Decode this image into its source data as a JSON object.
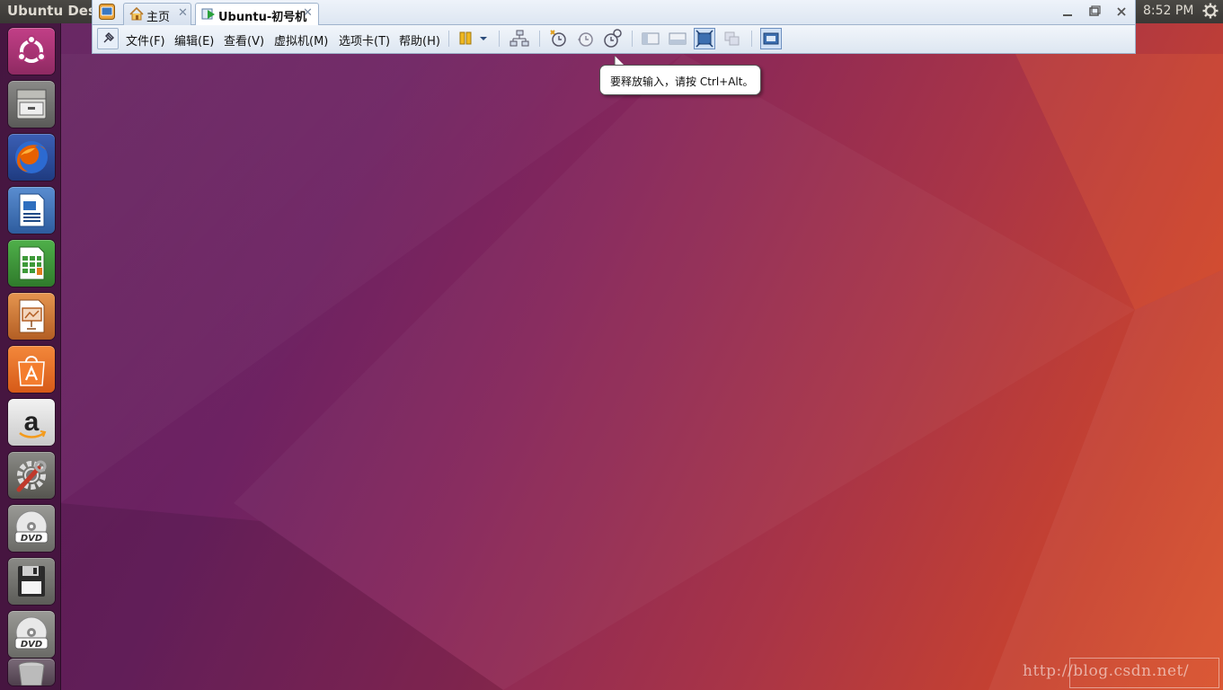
{
  "panel": {
    "title": "Ubuntu Desktop",
    "clock": "8:52 PM"
  },
  "launcher": {
    "items": [
      {
        "name": "ubuntu-dash",
        "icon": "ubuntu-logo-icon"
      },
      {
        "name": "files",
        "icon": "file-cabinet-icon"
      },
      {
        "name": "firefox",
        "icon": "firefox-icon"
      },
      {
        "name": "libreoffice-writer",
        "icon": "writer-icon"
      },
      {
        "name": "libreoffice-calc",
        "icon": "calc-icon"
      },
      {
        "name": "libreoffice-impress",
        "icon": "impress-icon"
      },
      {
        "name": "software-center",
        "icon": "shopping-bag-icon"
      },
      {
        "name": "amazon",
        "icon": "amazon-icon"
      },
      {
        "name": "system-settings",
        "icon": "settings-wrench-icon"
      },
      {
        "name": "dvd-1",
        "icon": "dvd-icon"
      },
      {
        "name": "floppy",
        "icon": "floppy-icon"
      },
      {
        "name": "dvd-2",
        "icon": "dvd-icon"
      },
      {
        "name": "trash",
        "icon": "trash-icon"
      }
    ]
  },
  "vm_window": {
    "tabs": [
      {
        "label": "主页",
        "icon": "home-icon"
      },
      {
        "label": "Ubuntu-初号机",
        "icon": "vm-running-icon"
      }
    ],
    "menu": [
      "文件(F)",
      "编辑(E)",
      "查看(V)",
      "虚拟机(M)",
      "选项卡(T)",
      "帮助(H)"
    ],
    "dvd_label": "DVD"
  },
  "tooltip": {
    "text": "要释放输入，请按 Ctrl+Alt。"
  },
  "watermark": {
    "text": "http://blog.csdn.net/"
  },
  "colors": {
    "launcher_bg": "#3c1237",
    "wallpaper_start": "#5e1c5a",
    "wallpaper_end": "#d9512b",
    "vm_chrome": "#dde6f2"
  }
}
